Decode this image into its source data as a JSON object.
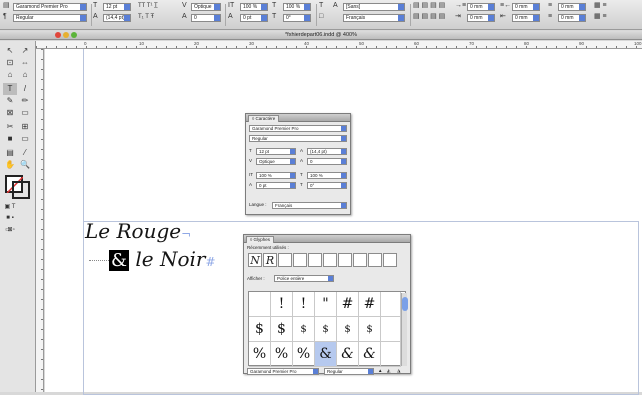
{
  "control_bar": {
    "font_family": "Garamond Premier Pro",
    "font_style": "Regular",
    "font_size": "12 pt",
    "leading": "(14,4 pt)",
    "kerning": "Optique",
    "tracking": "0",
    "scale_v": "100 %",
    "scale_h": "100 %",
    "baseline": "0 pt",
    "skew": "0°",
    "language": "[Sans]",
    "language2": "Français",
    "indent1": "0 mm",
    "indent2": "0 mm",
    "indent3": "0 mm",
    "indent4": "0 mm"
  },
  "document": {
    "title": "*fxhierdepart06.indd @ 400%",
    "ruler_ticks": [
      "0",
      "10",
      "20",
      "30",
      "40",
      "50",
      "60",
      "70",
      "80",
      "90",
      "100"
    ]
  },
  "canvas": {
    "line1": "Le Rouge",
    "line1_mark": "¬",
    "amp": "&",
    "line2": "le Noir",
    "line2_mark": "#"
  },
  "char_panel": {
    "tab": "◊ Caractère",
    "font_family": "Garamond Premier Pro",
    "font_style": "Regular",
    "size": "12 pt",
    "leading": "(14,4 pt)",
    "kerning": "Optique",
    "tracking": "0",
    "scale_v": "100 %",
    "scale_h": "100 %",
    "baseline": "0 pt",
    "skew": "0°",
    "language_label": "Langue :",
    "language": "Français"
  },
  "glyph_panel": {
    "tab": "◊ Glyphes",
    "recent_label": "Récemment utilisés :",
    "recent": [
      "N",
      "R"
    ],
    "show_label": "Afficher :",
    "show_value": "Police entière",
    "rows": [
      [
        "",
        "!",
        "!",
        "\"",
        "#",
        "#",
        ""
      ],
      [
        "$",
        "$",
        "$",
        "$",
        "$",
        "$",
        ""
      ],
      [
        "%",
        "%",
        "%",
        "&",
        "&",
        "&",
        ""
      ]
    ],
    "selected": [
      2,
      3
    ],
    "footer_font": "Garamond Premier Pro",
    "footer_style": "Regular"
  },
  "colors": {
    "selection_blue": "#b6c9ee",
    "dropdown_blue": "#5a7fd6",
    "frame_edge": "#b9c4dc"
  }
}
